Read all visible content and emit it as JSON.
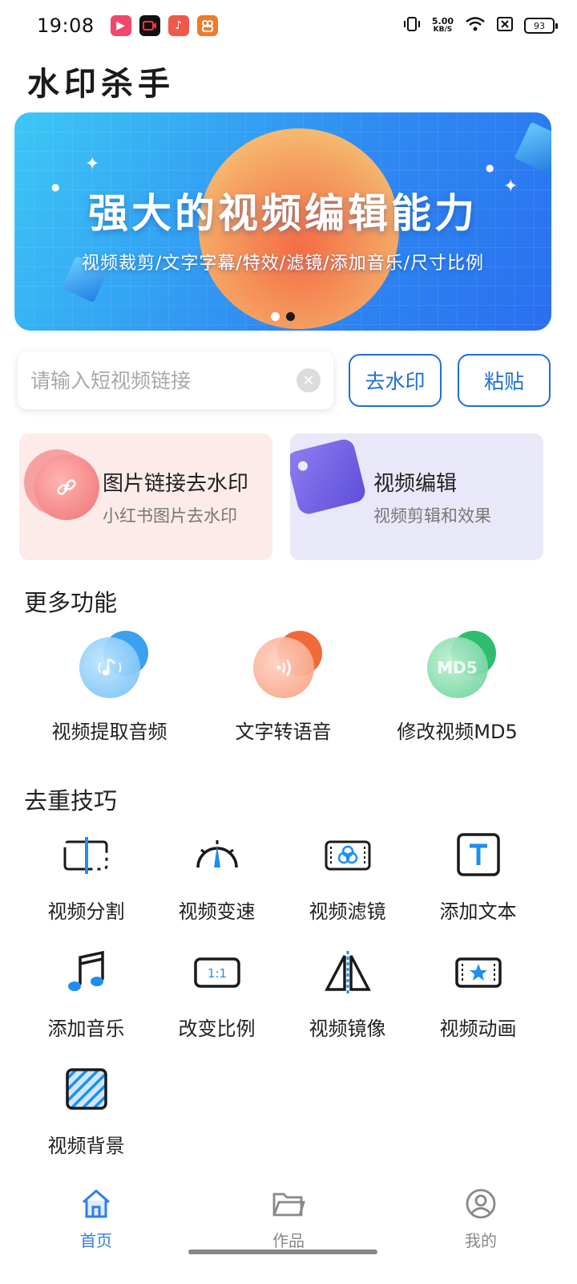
{
  "status_bar": {
    "time": "19:08",
    "network_speed": "5.00",
    "network_unit": "KB/S",
    "battery": "93",
    "notification_icons": [
      "video-app-icon",
      "camera-app-icon",
      "music-app-icon",
      "social-app-icon"
    ],
    "system_icons": [
      "vibrate-icon",
      "wifi-icon",
      "sim-icon",
      "battery-icon"
    ]
  },
  "app": {
    "title": "水印杀手"
  },
  "banner": {
    "title": "强大的视频编辑能力",
    "subtitle": "视频裁剪/文字字幕/特效/滤镜/添加音乐/尺寸比例",
    "page_index": 2,
    "page_count": 2
  },
  "link_input": {
    "placeholder": "请输入短视频链接",
    "value": ""
  },
  "buttons": {
    "remove_watermark": "去水印",
    "paste": "粘贴"
  },
  "feature_cards": [
    {
      "title": "图片链接去水印",
      "subtitle": "小红书图片去水印",
      "icon": "link-icon",
      "color": "#fdebea"
    },
    {
      "title": "视频编辑",
      "subtitle": "视频剪辑和效果",
      "icon": "video-tag-icon",
      "color": "#e9e8f8"
    }
  ],
  "more_section": {
    "title": "更多功能",
    "items": [
      {
        "label": "视频提取音频",
        "icon": "music-note-icon",
        "color": "#3aa0f0"
      },
      {
        "label": "文字转语音",
        "icon": "sound-wave-icon",
        "color": "#f06a3a"
      },
      {
        "label": "修改视频MD5",
        "icon": "md5-icon",
        "glyph": "MD5",
        "color": "#2ebd6e"
      }
    ]
  },
  "tips_section": {
    "title": "去重技巧",
    "items": [
      {
        "label": "视频分割",
        "icon": "split-icon"
      },
      {
        "label": "视频变速",
        "icon": "speed-gauge-icon"
      },
      {
        "label": "视频滤镜",
        "icon": "filter-icon"
      },
      {
        "label": "添加文本",
        "icon": "text-icon",
        "glyph": "T"
      },
      {
        "label": "添加音乐",
        "icon": "music-icon"
      },
      {
        "label": "改变比例",
        "icon": "ratio-icon",
        "glyph": "1:1"
      },
      {
        "label": "视频镜像",
        "icon": "mirror-icon"
      },
      {
        "label": "视频动画",
        "icon": "animation-icon"
      },
      {
        "label": "视频背景",
        "icon": "background-icon"
      }
    ]
  },
  "bottom_nav": {
    "items": [
      {
        "label": "首页",
        "icon": "home-icon",
        "active": true
      },
      {
        "label": "作品",
        "icon": "folder-icon",
        "active": false
      },
      {
        "label": "我的",
        "icon": "profile-icon",
        "active": false
      }
    ]
  },
  "colors": {
    "accent": "#1f6fd6",
    "nav_active": "#2f7ee8",
    "nav_inactive": "#888888",
    "icon_blue": "#1e8ff0"
  }
}
